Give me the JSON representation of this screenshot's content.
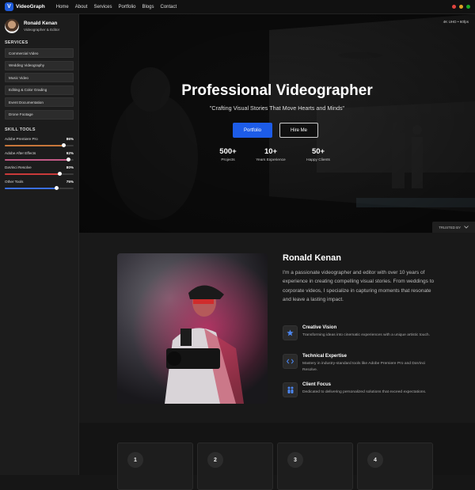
{
  "app": {
    "name": "VideoGraph",
    "logo_letter": "V"
  },
  "nav": {
    "items": [
      "Home",
      "About",
      "Services",
      "Portfolio",
      "Blogs",
      "Contact"
    ]
  },
  "window_dots": [
    "#e0443e",
    "#dea123",
    "#1aab29"
  ],
  "profile": {
    "name": "Ronald Kenan",
    "role": "Videographer & Editor"
  },
  "sidebar": {
    "services_title": "SERVICES",
    "services": [
      "Commercial Video",
      "Wedding Videography",
      "Music Video",
      "Editing & Color Grading",
      "Event Documentation",
      "Drone Footage"
    ],
    "skills_title": "SKILL TOOLS",
    "skills": [
      {
        "name": "Adobe Premiere Pro",
        "percent_label": "86%",
        "value": 0.86,
        "color": "#c8763b"
      },
      {
        "name": "Adobe After Effects",
        "percent_label": "92%",
        "value": 0.92,
        "color": "#c25a86"
      },
      {
        "name": "DaVinci Resolve",
        "percent_label": "80%",
        "value": 0.8,
        "color": "#c93a3a"
      },
      {
        "name": "Other Tools",
        "percent_label": "75%",
        "value": 0.75,
        "color": "#3a6fe0"
      }
    ]
  },
  "hero": {
    "badge": "4K UHD • 60fps",
    "title": "Professional Videographer",
    "subtitle": "\"Crafting Visual Stories That Move Hearts and Minds\"",
    "primary_button": "Portfolio",
    "secondary_button": "Hire Me",
    "stats": [
      {
        "value": "500+",
        "label": "Projects"
      },
      {
        "value": "10+",
        "label": "Years Experience"
      },
      {
        "value": "50+",
        "label": "Happy Clients"
      }
    ],
    "trusted_label": "TRUSTED BY"
  },
  "about": {
    "name": "Ronald Kenan",
    "bio": "I'm a passionate videographer and editor with over 10 years of experience in creating compelling visual stories. From weddings to corporate videos, I specialize in capturing moments that resonate and leave a lasting impact.",
    "features": [
      {
        "icon": "star-icon",
        "title": "Creative Vision",
        "desc": "Transforming ideas into cinematic experiences with a unique artistic touch."
      },
      {
        "icon": "code-icon",
        "title": "Technical Expertise",
        "desc": "Mastery in industry-standard tools like Adobe Premiere Pro and DaVinci Resolve."
      },
      {
        "icon": "people-icon",
        "title": "Client Focus",
        "desc": "Dedicated to delivering personalized solutions that exceed expectations."
      }
    ]
  },
  "steps": [
    "1",
    "2",
    "3",
    "4"
  ],
  "colors": {
    "accent": "#1d5ce8",
    "feature_icon": "#4b86f0"
  }
}
